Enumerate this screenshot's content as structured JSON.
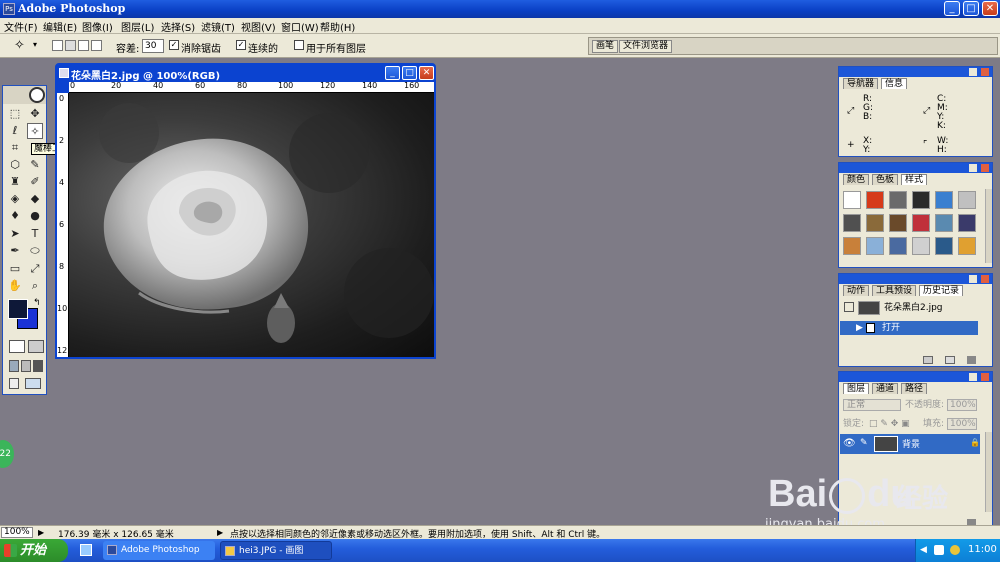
{
  "window": {
    "title": "Adobe Photoshop"
  },
  "menubar": {
    "items": [
      "文件(F)",
      "编辑(E)",
      "图像(I)",
      "图层(L)",
      "选择(S)",
      "滤镜(T)",
      "视图(V)",
      "窗口(W)",
      "帮助(H)"
    ]
  },
  "options": {
    "tolerance_label": "容差:",
    "tolerance_value": "30",
    "antialias_label": "消除锯齿",
    "contiguous_label": "连续的",
    "all_layers_label": "用于所有图层",
    "brush_well": "画笔",
    "file_browser_well": "文件浏览器"
  },
  "toolbox": {
    "tooltip": "魔棒工具(W)",
    "foreground_color": "#0e1838",
    "background_color": "#1a33d6"
  },
  "document": {
    "title": "花朵黑白2.jpg @ 100%(RGB)",
    "ruler_top": [
      "0",
      "20",
      "40",
      "60",
      "80",
      "100",
      "120",
      "140",
      "160"
    ],
    "ruler_left": [
      "0",
      "2",
      "4",
      "6",
      "8",
      "10",
      "12"
    ]
  },
  "navigator": {
    "tabs": [
      "导航器",
      "信息"
    ],
    "rgb": [
      "R:",
      "G:",
      "B:"
    ],
    "cmyk": [
      "C:",
      "M:",
      "Y:",
      "K:"
    ],
    "xy": [
      "X:",
      "Y:"
    ],
    "wh": [
      "W:",
      "H:"
    ]
  },
  "swatches": {
    "tabs": [
      "颜色",
      "色板",
      "样式"
    ],
    "colors": [
      "#ffffff",
      "#d63a1a",
      "#6a6a6a",
      "#2a2a2a",
      "#3a7fd0",
      "#c0c0c0",
      "#505050",
      "#8a6a3a",
      "#6a4a2a",
      "#c0303a",
      "#5a8ab0",
      "#3a3a6a",
      "#c8803a",
      "#8ab0d8",
      "#4a6aa0",
      "#d0d0d0",
      "#2a5a8a",
      "#e0a030"
    ]
  },
  "history": {
    "tabs": [
      "动作",
      "工具预设",
      "历史记录"
    ],
    "snapshot": "花朵黑白2.jpg",
    "step": "打开"
  },
  "layers": {
    "tabs": [
      "图层",
      "通道",
      "路径"
    ],
    "blend_mode": "正常",
    "opacity_label": "不透明度:",
    "opacity_value": "100%",
    "lock_label": "锁定:",
    "fill_label": "填充:",
    "fill_value": "100%",
    "layer_name": "背景"
  },
  "status": {
    "zoom": "100%",
    "doc_size": "176.39 毫米 x 126.65 毫米",
    "hint": "点按以选择相同颜色的邻近像素或移动选区外框。要用附加选项，使用 Shift、Alt 和 Ctrl 键。"
  },
  "taskbar": {
    "start_label": "开始",
    "tasks": [
      "Adobe Photoshop",
      "hei3.JPG - 画图"
    ],
    "clock": "11:00"
  },
  "side_badge": "22",
  "watermark": {
    "brand": "Bai",
    "du": "du",
    "cn": "经验",
    "url": "jingyan.baidu.com"
  }
}
